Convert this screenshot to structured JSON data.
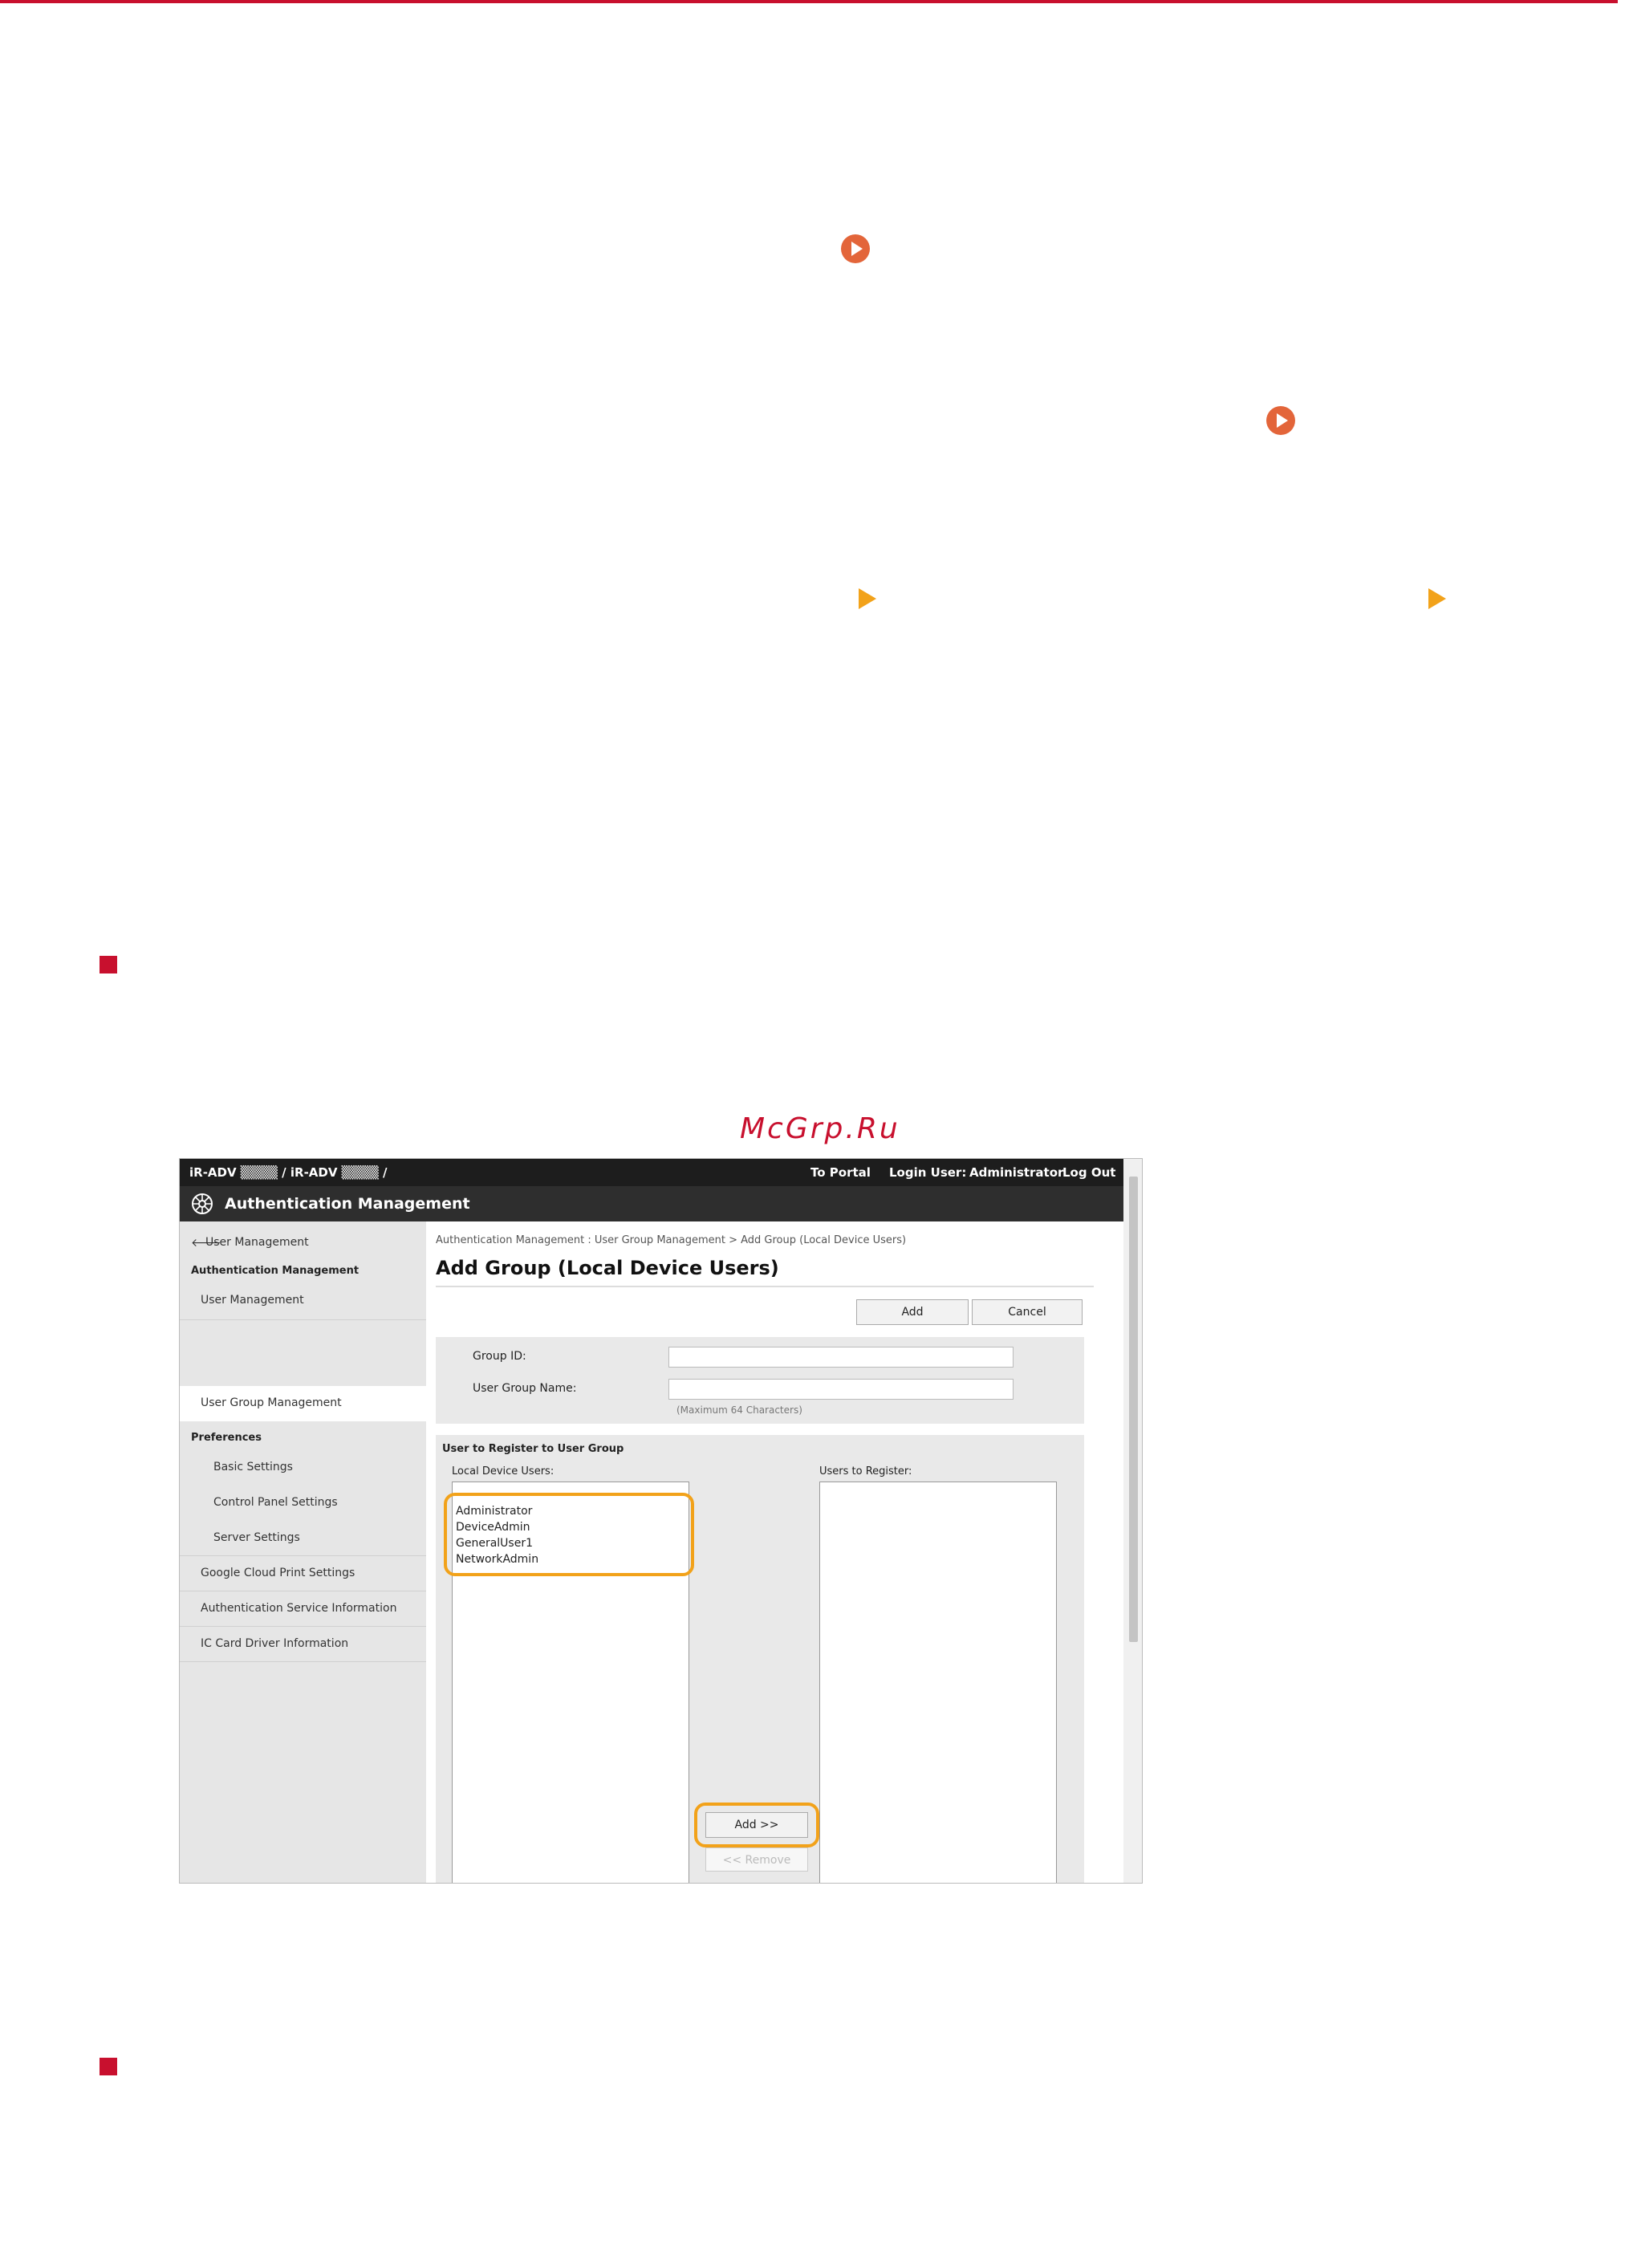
{
  "watermark": "McGrp.Ru",
  "colors": {
    "brand_red": "#c8102e",
    "bullet_orange": "#e3653a",
    "highlight": "#f2a21a"
  },
  "icons": [
    "circle-arrow-icon",
    "triangle-arrow-icon",
    "square-bullet-icon",
    "authentication-logo-icon",
    "back-arrow-icon"
  ],
  "ui": {
    "header": {
      "device_label": "iR-ADV ▒▒▒▒ / iR-ADV ▒▒▒▒ /",
      "to_portal": "To Portal",
      "login_user_label": "Login User:",
      "login_user_value": "Administrator",
      "logout": "Log Out",
      "app_title": "Authentication Management"
    },
    "sidebar": {
      "back_link": "User Management",
      "section1": "Authentication Management",
      "item_user_mgmt": "User Management",
      "item_group_mgmt": "User Group Management",
      "section2": "Preferences",
      "item_basic": "Basic Settings",
      "item_control_panel": "Control Panel Settings",
      "item_server": "Server Settings",
      "item_google": "Google Cloud Print Settings",
      "item_auth_info": "Authentication Service Information",
      "item_ic_card": "IC Card Driver Information"
    },
    "main": {
      "breadcrumb": "Authentication Management : User Group Management > Add Group (Local Device Users)",
      "title": "Add Group (Local Device Users)",
      "add_button": "Add",
      "cancel_button": "Cancel",
      "group_id_label": "Group ID:",
      "group_id_value": "",
      "group_name_label": "User Group Name:",
      "group_name_value": "",
      "max_chars_note": "(Maximum 64 Characters)",
      "register_section": "User to Register to User Group",
      "local_users_label": "Local Device Users:",
      "local_users": [
        "Administrator",
        "DeviceAdmin",
        "GeneralUser1",
        "NetworkAdmin"
      ],
      "users_to_register_label": "Users to Register:",
      "add_move_button": "Add >>",
      "remove_button": "<< Remove"
    }
  }
}
